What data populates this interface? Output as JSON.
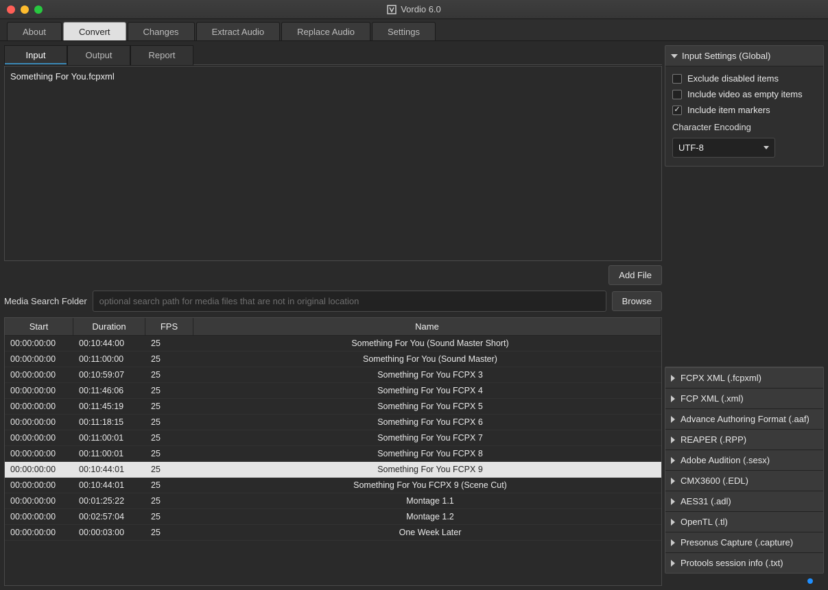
{
  "title": "Vordio 6.0",
  "mainTabs": [
    "About",
    "Convert",
    "Changes",
    "Extract Audio",
    "Replace Audio",
    "Settings"
  ],
  "mainTabActive": 1,
  "subTabs": [
    "Input",
    "Output",
    "Report"
  ],
  "subTabActive": 0,
  "inputFile": "Something For You.fcpxml",
  "addFileLabel": "Add File",
  "mediaSearchLabel": "Media Search Folder",
  "mediaSearchPlaceholder": "optional search path for media files that are not in original location",
  "browseLabel": "Browse",
  "tableHeaders": {
    "start": "Start",
    "duration": "Duration",
    "fps": "FPS",
    "name": "Name"
  },
  "rows": [
    {
      "start": "00:00:00:00",
      "dur": "00:10:44:00",
      "fps": "25",
      "name": "Something For You (Sound Master Short)",
      "sel": false
    },
    {
      "start": "00:00:00:00",
      "dur": "00:11:00:00",
      "fps": "25",
      "name": "Something For You (Sound Master)",
      "sel": false
    },
    {
      "start": "00:00:00:00",
      "dur": "00:10:59:07",
      "fps": "25",
      "name": "Something For You FCPX 3",
      "sel": false
    },
    {
      "start": "00:00:00:00",
      "dur": "00:11:46:06",
      "fps": "25",
      "name": "Something For You FCPX 4",
      "sel": false
    },
    {
      "start": "00:00:00:00",
      "dur": "00:11:45:19",
      "fps": "25",
      "name": "Something For You FCPX 5",
      "sel": false
    },
    {
      "start": "00:00:00:00",
      "dur": "00:11:18:15",
      "fps": "25",
      "name": "Something For You FCPX 6",
      "sel": false
    },
    {
      "start": "00:00:00:00",
      "dur": "00:11:00:01",
      "fps": "25",
      "name": "Something For You FCPX 7",
      "sel": false
    },
    {
      "start": "00:00:00:00",
      "dur": "00:11:00:01",
      "fps": "25",
      "name": "Something For You FCPX 8",
      "sel": false
    },
    {
      "start": "00:00:00:00",
      "dur": "00:10:44:01",
      "fps": "25",
      "name": "Something For You FCPX 9",
      "sel": true
    },
    {
      "start": "00:00:00:00",
      "dur": "00:10:44:01",
      "fps": "25",
      "name": "Something For You FCPX 9 (Scene Cut)",
      "sel": false
    },
    {
      "start": "00:00:00:00",
      "dur": "00:01:25:22",
      "fps": "25",
      "name": "Montage 1.1",
      "sel": false
    },
    {
      "start": "00:00:00:00",
      "dur": "00:02:57:04",
      "fps": "25",
      "name": "Montage 1.2",
      "sel": false
    },
    {
      "start": "00:00:00:00",
      "dur": "00:00:03:00",
      "fps": "25",
      "name": "One Week Later",
      "sel": false
    }
  ],
  "inputSettingsTitle": "Input Settings (Global)",
  "settings": {
    "excludeDisabled": {
      "label": "Exclude disabled items",
      "checked": false
    },
    "includeVideoEmpty": {
      "label": "Include video as empty items",
      "checked": false
    },
    "includeMarkers": {
      "label": "Include item markers",
      "checked": true
    },
    "encodingLabel": "Character Encoding",
    "encodingValue": "UTF-8"
  },
  "formats": [
    "FCPX XML (.fcpxml)",
    "FCP XML (.xml)",
    "Advance Authoring Format (.aaf)",
    "REAPER (.RPP)",
    "Adobe Audition (.sesx)",
    "CMX3600 (.EDL)",
    "AES31 (.adl)",
    "OpenTL (.tl)",
    "Presonus Capture (.capture)",
    "Protools session info (.txt)"
  ]
}
